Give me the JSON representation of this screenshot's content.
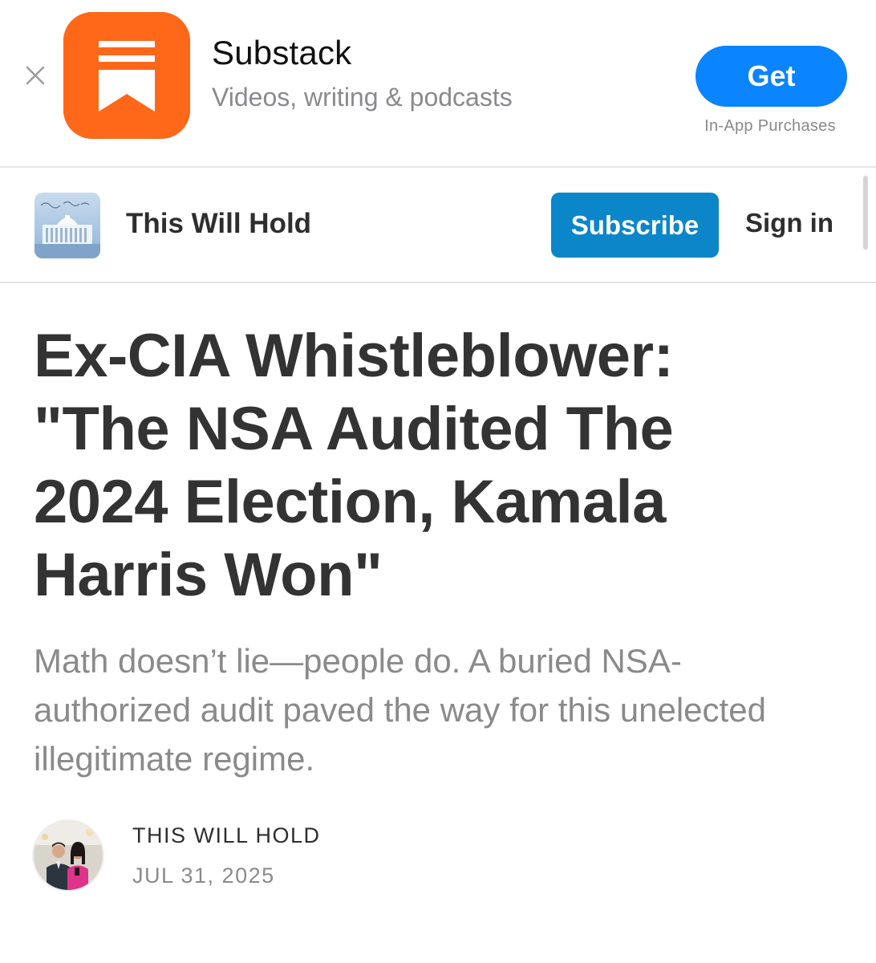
{
  "app_banner": {
    "app_name": "Substack",
    "tagline": "Videos, writing & podcasts",
    "get_label": "Get",
    "iap_note": "In-App Purchases",
    "close_icon": "close-icon",
    "app_icon": "substack-bookmark-icon",
    "colors": {
      "icon_bg": "#ff6719",
      "get_button": "#0a84ff"
    }
  },
  "publication": {
    "name": "This Will Hold",
    "subscribe_label": "Subscribe",
    "signin_label": "Sign in",
    "colors": {
      "subscribe_button": "#0b86c9"
    }
  },
  "article": {
    "title": "Ex-CIA Whistleblower: \"The NSA Audited The 2024 Election, Kamala Harris Won\"",
    "subtitle": "Math doesn’t lie—people do. A buried NSA-authorized audit paved the way for this unelected illegitimate regime.",
    "byline": "THIS WILL HOLD",
    "date": "JUL 31, 2025"
  }
}
